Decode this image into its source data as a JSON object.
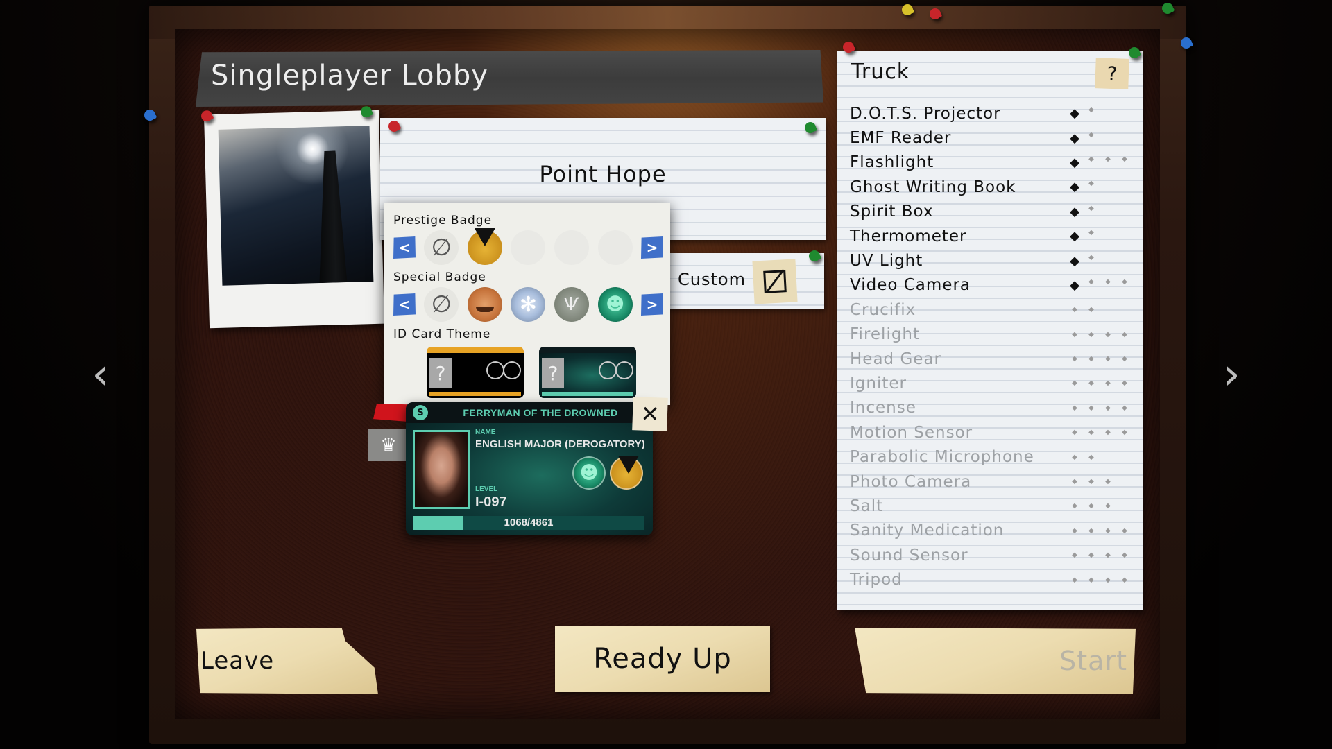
{
  "title": "Singleplayer Lobby",
  "map": {
    "name": "Point Hope",
    "difficulty_label": "Custom",
    "edit_icon": "edit-icon"
  },
  "customization": {
    "prestige_badge": {
      "label": "Prestige Badge",
      "prev": "<",
      "next": ">",
      "slots": [
        "none",
        "ferryman-prestige",
        "empty",
        "empty",
        "empty"
      ]
    },
    "special_badge": {
      "label": "Special Badge",
      "prev": "<",
      "next": ">",
      "slots": [
        "none",
        "pumpkin",
        "snowflake",
        "horned",
        "drowned"
      ]
    },
    "id_card_theme": {
      "label": "ID Card Theme",
      "themes": [
        {
          "id": "ferryman-orange",
          "placeholder": "?"
        },
        {
          "id": "drowned-teal",
          "placeholder": "?"
        }
      ]
    }
  },
  "id_card": {
    "header": "FERRYMAN OF THE DROWNED",
    "platform_icon": "steam-icon",
    "name_label": "NAME",
    "name": "ENGLISH MAJOR (DEROGATORY)",
    "level_label": "LEVEL",
    "level": "I-097",
    "xp_current": 1068,
    "xp_max": 4861,
    "xp_text": "1068/4861",
    "close": "✕",
    "host_icon": "crown-icon",
    "accent_color": "#5dcdb0"
  },
  "truck": {
    "title": "Truck",
    "help": "?",
    "equipment": [
      {
        "name": "D.O.T.S. Projector",
        "owned": true,
        "tiers": [
          true,
          false
        ]
      },
      {
        "name": "EMF Reader",
        "owned": true,
        "tiers": [
          true,
          false
        ]
      },
      {
        "name": "Flashlight",
        "owned": true,
        "tiers": [
          true,
          false,
          false,
          false
        ]
      },
      {
        "name": "Ghost Writing Book",
        "owned": true,
        "tiers": [
          true,
          false
        ]
      },
      {
        "name": "Spirit Box",
        "owned": true,
        "tiers": [
          true,
          false
        ]
      },
      {
        "name": "Thermometer",
        "owned": true,
        "tiers": [
          true,
          false
        ]
      },
      {
        "name": "UV Light",
        "owned": true,
        "tiers": [
          true,
          false
        ]
      },
      {
        "name": "Video Camera",
        "owned": true,
        "tiers": [
          true,
          false,
          false,
          false
        ]
      },
      {
        "name": "Crucifix",
        "owned": false,
        "tiers": [
          false,
          false
        ]
      },
      {
        "name": "Firelight",
        "owned": false,
        "tiers": [
          false,
          false,
          false,
          false
        ]
      },
      {
        "name": "Head Gear",
        "owned": false,
        "tiers": [
          false,
          false,
          false,
          false
        ]
      },
      {
        "name": "Igniter",
        "owned": false,
        "tiers": [
          false,
          false,
          false,
          false
        ]
      },
      {
        "name": "Incense",
        "owned": false,
        "tiers": [
          false,
          false,
          false,
          false
        ]
      },
      {
        "name": "Motion Sensor",
        "owned": false,
        "tiers": [
          false,
          false,
          false,
          false
        ]
      },
      {
        "name": "Parabolic Microphone",
        "owned": false,
        "tiers": [
          false,
          false
        ]
      },
      {
        "name": "Photo Camera",
        "owned": false,
        "tiers": [
          false,
          false,
          false
        ]
      },
      {
        "name": "Salt",
        "owned": false,
        "tiers": [
          false,
          false,
          false
        ]
      },
      {
        "name": "Sanity Medication",
        "owned": false,
        "tiers": [
          false,
          false,
          false,
          false
        ]
      },
      {
        "name": "Sound Sensor",
        "owned": false,
        "tiers": [
          false,
          false,
          false,
          false
        ]
      },
      {
        "name": "Tripod",
        "owned": false,
        "tiers": [
          false,
          false,
          false,
          false
        ]
      }
    ]
  },
  "buttons": {
    "leave": "Leave",
    "ready_up": "Ready Up",
    "start": "Start"
  },
  "navigation": {
    "prev": "‹",
    "next": "›"
  }
}
